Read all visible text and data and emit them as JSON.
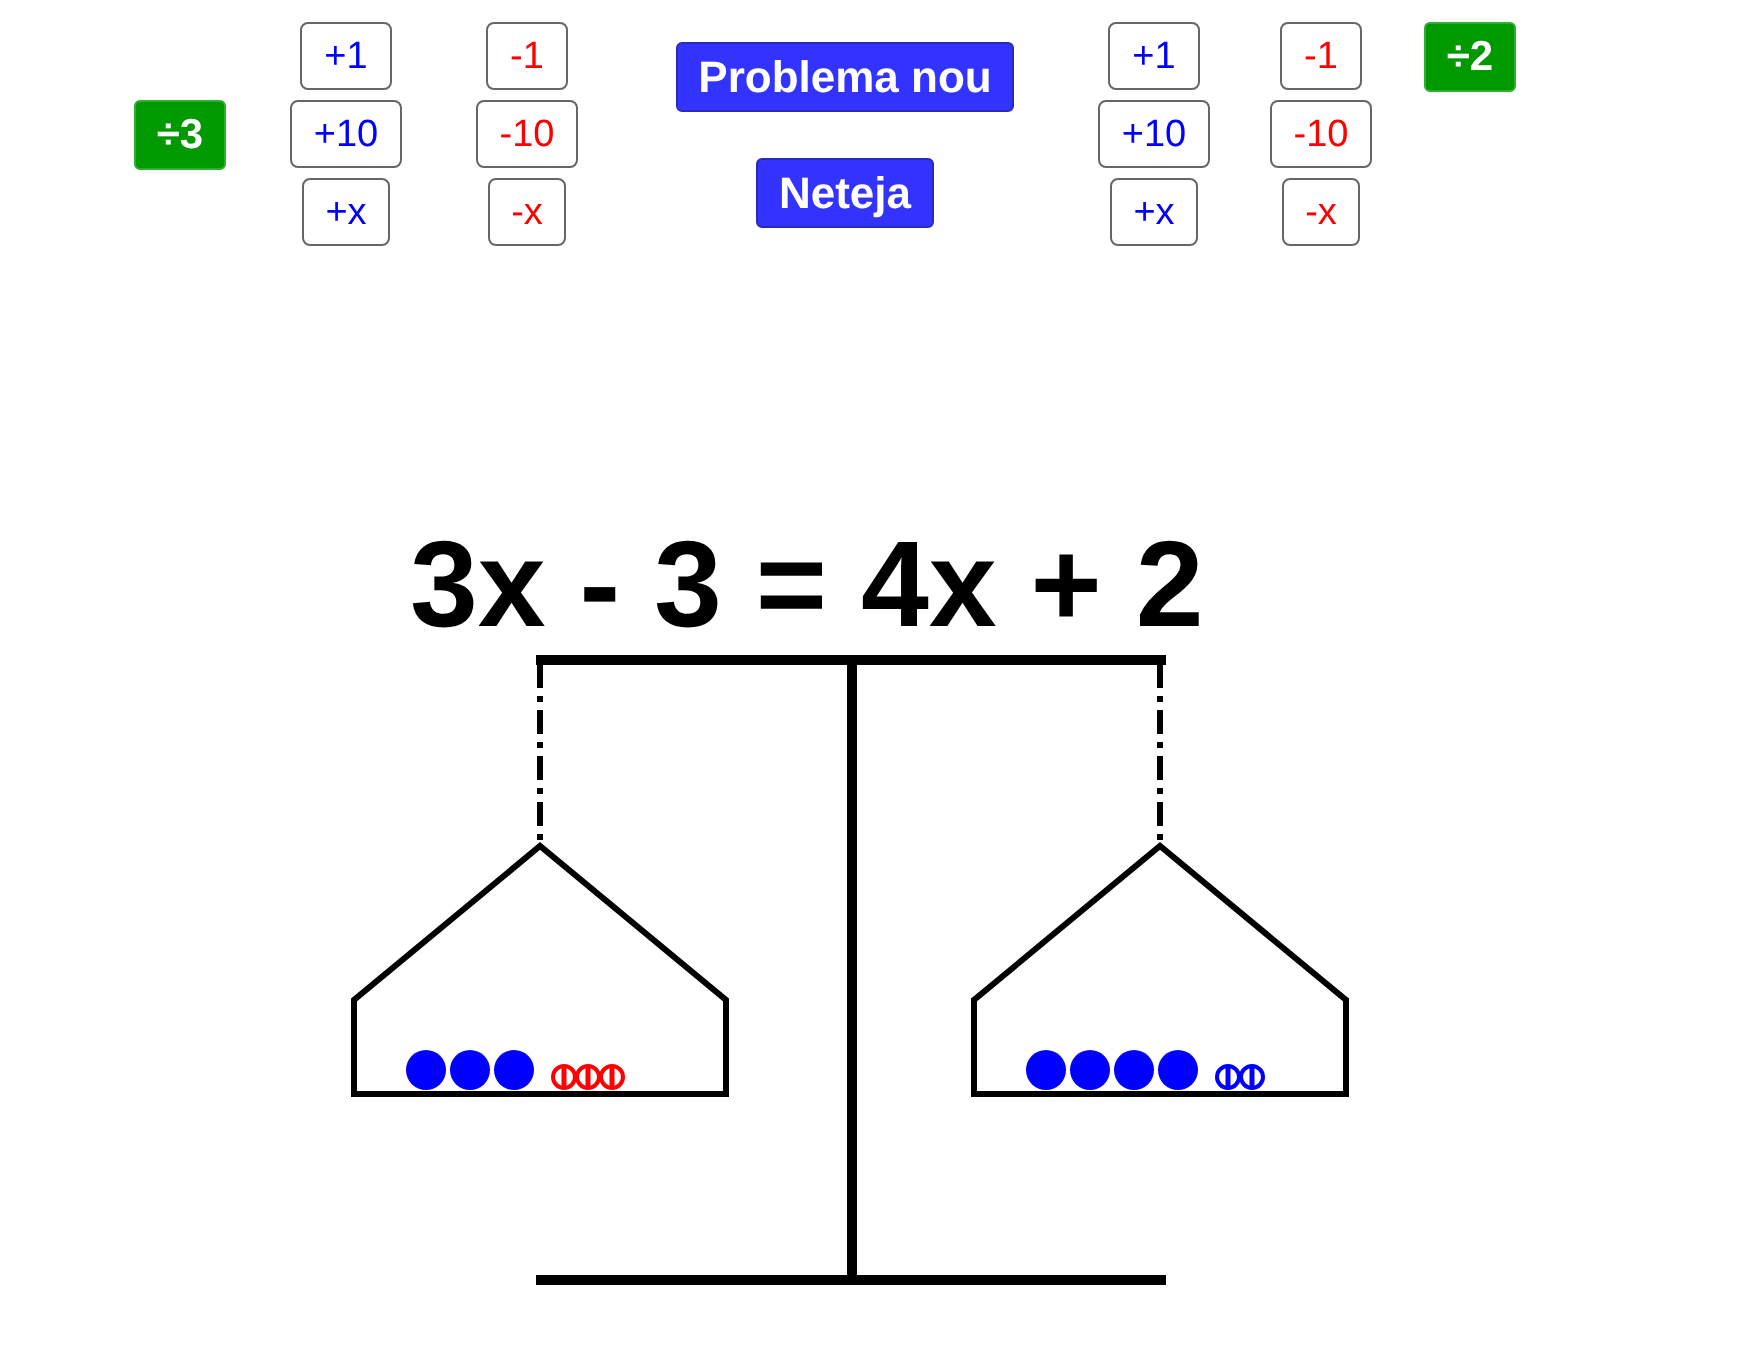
{
  "left_controls": {
    "divide_button": "÷3",
    "add_buttons": [
      "+1",
      "+10",
      "+x"
    ],
    "subtract_buttons": [
      "-1",
      "-10",
      "-x"
    ]
  },
  "center_buttons": [
    "Problema nou",
    "Neteja"
  ],
  "right_controls": {
    "add_buttons": [
      "+1",
      "+10",
      "+x"
    ],
    "subtract_buttons": [
      "-1",
      "-10",
      "-x"
    ],
    "divide_button": "÷2"
  },
  "equation": "3x - 3 = 4x + 2",
  "scale": {
    "pans": [
      {
        "tokens": [
          {
            "kind": "x",
            "color": "#0000ff"
          },
          {
            "kind": "x",
            "color": "#0000ff"
          },
          {
            "kind": "x",
            "color": "#0000ff"
          },
          {
            "kind": "unit",
            "color": "#ff0000"
          },
          {
            "kind": "unit",
            "color": "#ff0000"
          },
          {
            "kind": "unit",
            "color": "#ff0000"
          }
        ]
      },
      {
        "tokens": [
          {
            "kind": "x",
            "color": "#0000ff"
          },
          {
            "kind": "x",
            "color": "#0000ff"
          },
          {
            "kind": "x",
            "color": "#0000ff"
          },
          {
            "kind": "x",
            "color": "#0000ff"
          },
          {
            "kind": "unit",
            "color": "#0000ff"
          },
          {
            "kind": "unit",
            "color": "#0000ff"
          }
        ]
      }
    ]
  }
}
